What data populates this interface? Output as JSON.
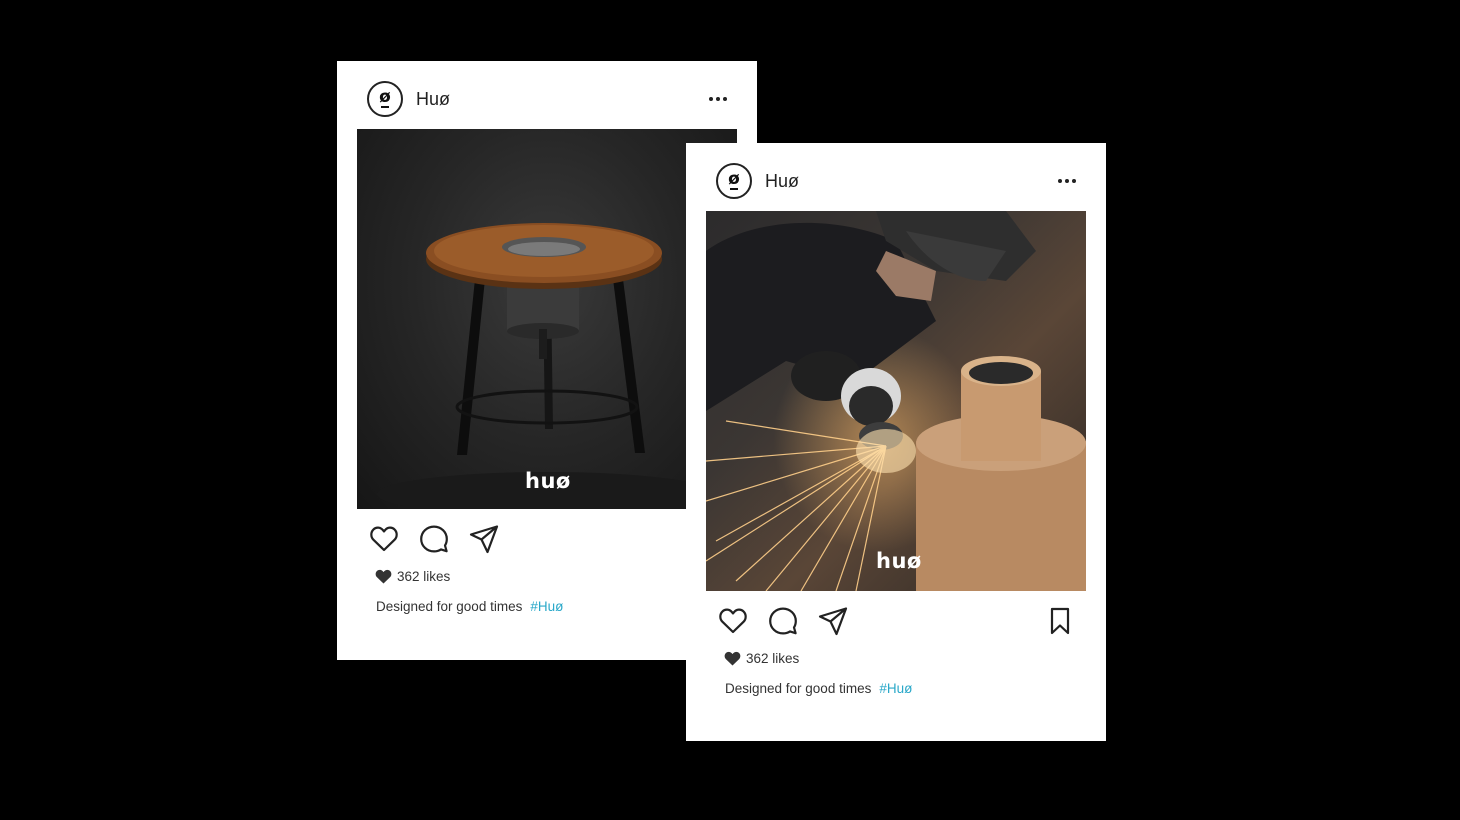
{
  "colors": {
    "background": "#000000",
    "card": "#ffffff",
    "text": "#333333",
    "hashtag": "#2aa8c9"
  },
  "posts": [
    {
      "account": {
        "name": "Huø",
        "avatar_glyph": "ø",
        "avatar_icon": "huo-logo-icon"
      },
      "more_icon": "more-horizontal-icon",
      "photo": {
        "subject": "fire-pit-table",
        "watermark": "huø"
      },
      "actions": [
        "heart-icon",
        "comment-icon",
        "share-icon"
      ],
      "likes": "362 likes",
      "caption": {
        "text": "Designed for good times",
        "hashtag": "#Huø"
      }
    },
    {
      "account": {
        "name": "Huø",
        "avatar_glyph": "ø",
        "avatar_icon": "huo-logo-icon"
      },
      "more_icon": "more-horizontal-icon",
      "photo": {
        "subject": "welder-grinding-sparks",
        "watermark": "huø"
      },
      "actions": [
        "heart-icon",
        "comment-icon",
        "share-icon",
        "bookmark-icon"
      ],
      "likes": "362 likes",
      "caption": {
        "text": "Designed for good times",
        "hashtag": "#Huø"
      }
    }
  ]
}
